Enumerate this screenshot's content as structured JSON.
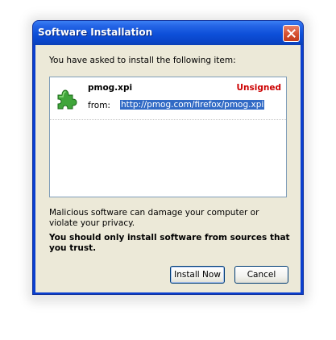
{
  "dialog": {
    "title": "Software Installation",
    "prompt": "You have asked to install the following item:",
    "item": {
      "name": "pmog.xpi",
      "status": "Unsigned",
      "from_label": "from:",
      "from_url": "http://pmog.com/firefox/pmog.xpi",
      "icon": "puzzle-piece-icon"
    },
    "warning": "Malicious software can damage your computer or violate your privacy.",
    "trust_note": "You should only install software from sources that you trust.",
    "buttons": {
      "install_label": "Install Now",
      "cancel_label": "Cancel"
    }
  },
  "colors": {
    "titlebar": "#0a45c8",
    "status_unsigned": "#cc0000",
    "selection": "#316ac5",
    "dialog_face": "#ece9d8",
    "close_button": "#d5502f"
  }
}
